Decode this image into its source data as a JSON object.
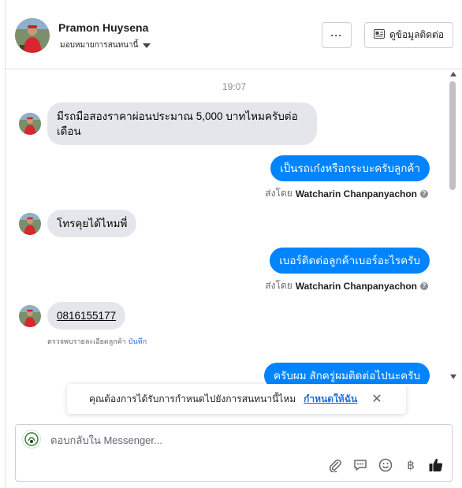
{
  "header": {
    "contact_name": "Pramon Huysena",
    "assign_label": "มอบหมายการสนทนานี้",
    "more_label": "···",
    "view_contact_label": "ดูข้อมูลติดต่อ"
  },
  "thread": {
    "timestamp": "19:07",
    "messages": [
      {
        "direction": "in",
        "text": "มีรถมือสองราคาผ่อนประมาณ 5,000 บาทไหมครับต่อเดือน"
      },
      {
        "direction": "out",
        "text": "เป็นรถเก๋งหรือกระบะครับลูกค้า",
        "sent_by_prefix": "ส่งโดย",
        "sent_by": "Watcharin Chanpanyachon"
      },
      {
        "direction": "in",
        "text": "โทรคุยได้ไหมพี่"
      },
      {
        "direction": "out",
        "text": "เบอร์ติดต่อลูกค้าเบอร์อะไรครับ",
        "sent_by_prefix": "ส่งโดย",
        "sent_by": "Watcharin Chanpanyachon"
      },
      {
        "direction": "in",
        "text": "0816155177",
        "detected_text": "ตรวจพบรายละเอียดลูกค้า",
        "detected_action": "บันทึก"
      },
      {
        "direction": "out",
        "text": "ครับผม สักครู่ผมติดต่อไปนะครับ"
      }
    ]
  },
  "banner": {
    "text": "คุณต้องการได้รับการกำหนดไปยังการสนทนานี้ไหม",
    "action": "กำหนดให้ฉัน",
    "close": "✕"
  },
  "composer": {
    "placeholder": "ตอบกลับใน Messenger...",
    "currency_symbol": "฿"
  },
  "colors": {
    "accent": "#0084ff",
    "incoming_bubble": "#e4e6eb",
    "link": "#216fdb"
  },
  "icons": [
    "person-avatar",
    "chevron-down-icon",
    "more-icon",
    "contact-card-icon",
    "info-icon",
    "close-icon",
    "messenger-page-icon",
    "paperclip-icon",
    "saved-reply-icon",
    "emoji-icon",
    "baht-icon",
    "thumbs-up-icon"
  ]
}
